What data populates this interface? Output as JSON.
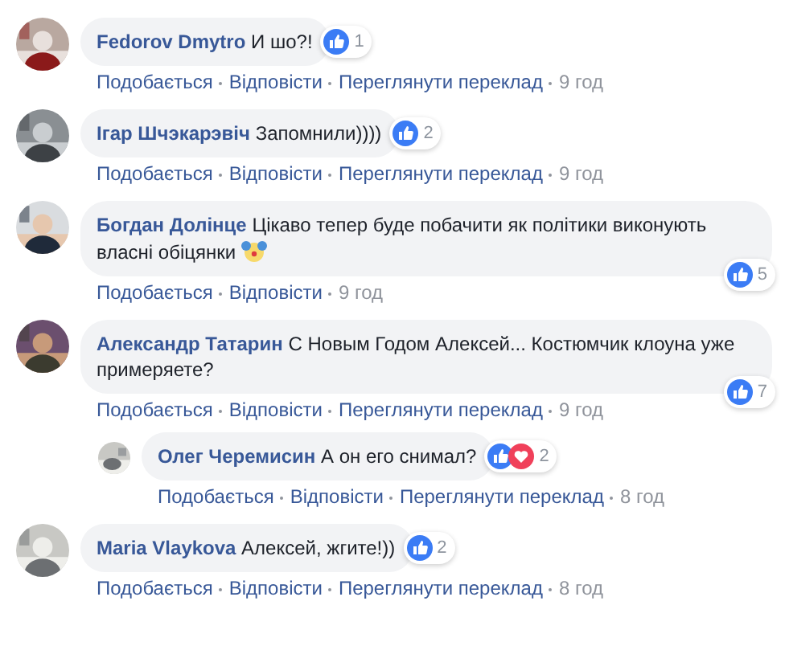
{
  "comments": [
    {
      "author": "Fedorov Dmytro",
      "text": "И шо?!",
      "kind": "short",
      "reactions": [
        {
          "kind": "like"
        }
      ],
      "count": "1",
      "actions": [
        "Подобається",
        "Відповісти",
        "Переглянути переклад"
      ],
      "time": "9 год"
    },
    {
      "author": "Ігар Шчэкарэвіч",
      "text": "Запомнили))))",
      "kind": "short",
      "reactions": [
        {
          "kind": "like"
        }
      ],
      "count": "2",
      "actions": [
        "Подобається",
        "Відповісти",
        "Переглянути переклад"
      ],
      "time": "9 год"
    },
    {
      "author": "Богдан Долінце",
      "text": "Цікаво тепер буде побачити як політики виконують власні обіцянки",
      "emoji": true,
      "kind": "long",
      "reactions": [
        {
          "kind": "like"
        }
      ],
      "count": "5",
      "actions": [
        "Подобається",
        "Відповісти"
      ],
      "time": "9 год"
    },
    {
      "author": "Александр Татарин",
      "text": "С Новым Годом Алексей... Костюмчик клоуна уже примеряете?",
      "kind": "long",
      "reactions": [
        {
          "kind": "like"
        }
      ],
      "count": "7",
      "actions": [
        "Подобається",
        "Відповісти",
        "Переглянути переклад"
      ],
      "time": "9 год",
      "replies": [
        {
          "author": "Олег Черемисин",
          "text": "А он его снимал?",
          "kind": "short",
          "reactions": [
            {
              "kind": "like"
            },
            {
              "kind": "love"
            }
          ],
          "count": "2",
          "actions": [
            "Подобається",
            "Відповісти",
            "Переглянути переклад"
          ],
          "time": "8 год"
        }
      ]
    },
    {
      "author": "Maria Vlaykova",
      "text": "Алексей, жгите!))",
      "kind": "short",
      "reactions": [
        {
          "kind": "like"
        }
      ],
      "count": "2",
      "actions": [
        "Подобається",
        "Відповісти",
        "Переглянути переклад"
      ],
      "time": "8 год"
    }
  ]
}
